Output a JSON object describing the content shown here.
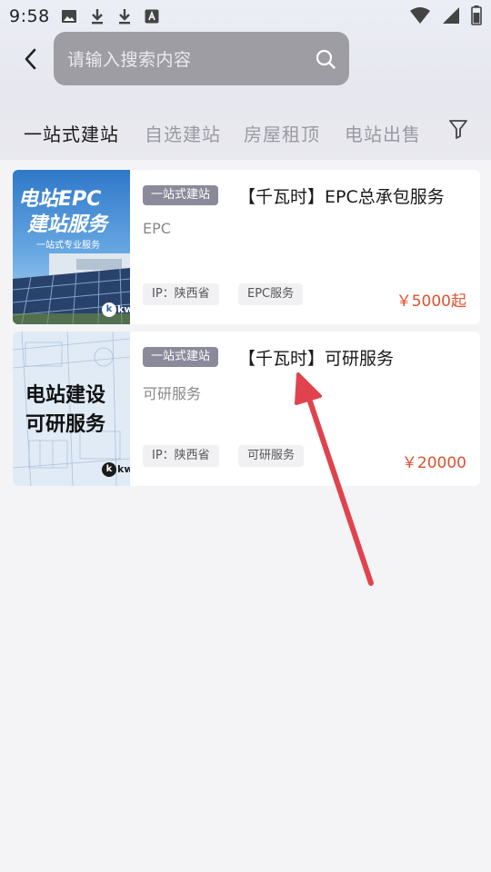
{
  "status_bar": {
    "time": "9:58"
  },
  "search": {
    "placeholder": "请输入搜索内容"
  },
  "tabs": [
    {
      "label": "一站式建站",
      "active": true
    },
    {
      "label": "自选建站",
      "active": false
    },
    {
      "label": "房屋租顶",
      "active": false
    },
    {
      "label": "电站出售",
      "active": false
    }
  ],
  "products": [
    {
      "category": "一站式建站",
      "title": "【千瓦时】EPC总承包服务",
      "subtitle": "EPC",
      "tags": [
        "IP：陕西省",
        "EPC服务"
      ],
      "price": "￥5000起",
      "thumb": {
        "line1": "电站EPC",
        "line2": "建站服务",
        "caption": "一站式专业服务",
        "logo": "kw"
      }
    },
    {
      "category": "一站式建站",
      "title": "【千瓦时】可研服务",
      "subtitle": "可研服务",
      "tags": [
        "IP：陕西省",
        "可研服务"
      ],
      "price": "￥20000",
      "thumb": {
        "line1": "电站建设",
        "line2": "可研服务",
        "logo": "kw"
      }
    }
  ],
  "colors": {
    "price": "#e0512d",
    "badge": "#8a8a9a",
    "annotation_arrow": "#e0434e"
  }
}
